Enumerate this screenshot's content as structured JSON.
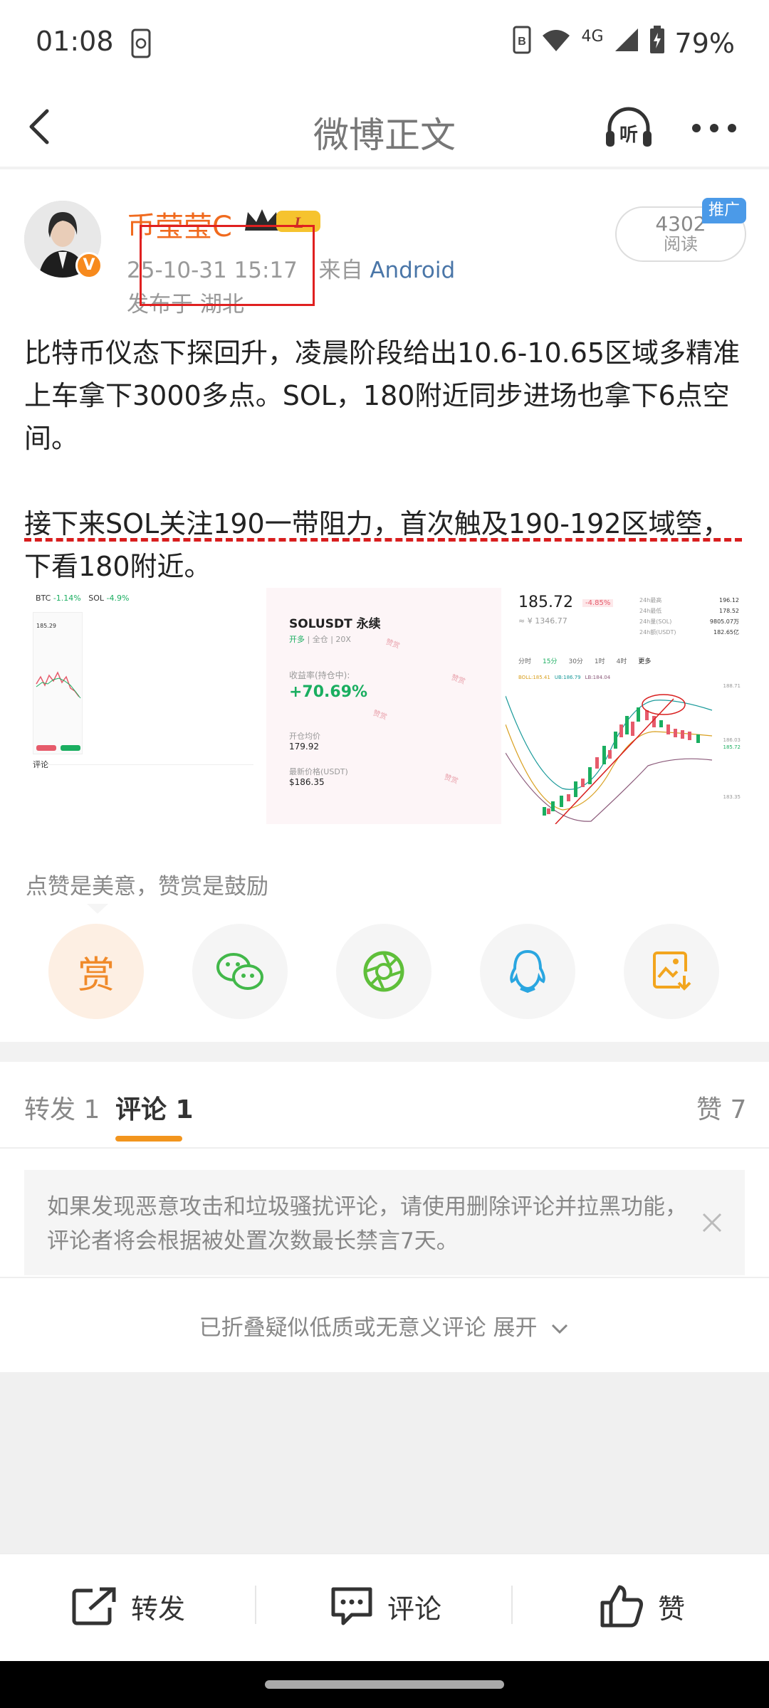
{
  "status": {
    "time": "01:08",
    "network": "4G",
    "battery": "79%"
  },
  "nav": {
    "title": "微博正文"
  },
  "post": {
    "username": "币莹莹C",
    "level_badge": "L",
    "date": "25-10-31 15:17",
    "source_prefix": "来自",
    "source": "Android",
    "location": "发布于 湖北",
    "reads": "4302",
    "reads_label": "阅读",
    "promo": "推广",
    "paragraph1": "比特币仪态下探回升，凌晨阶段给出10.6-10.65区域多精准上车拿下3000多点。SOL，180附近同步进场也拿下6点空间。",
    "paragraph2": "接下来SOL关注190一带阻力，首次触及190-192区域箜，下看180附近。"
  },
  "images": {
    "img1": {
      "ticker1": "BTC",
      "ticker1_change": "-1.14%",
      "ticker2": "SOL",
      "ticker2_change": "-4.9%",
      "price": "185.29",
      "tab": "评论"
    },
    "img2": {
      "symbol": "SOLUSDT 永续",
      "side": "开多",
      "mode": "全仓",
      "leverage": "20X",
      "roi_label": "收益率(持仓中):",
      "roi": "+70.69%",
      "entry_label": "开仓均价",
      "entry": "179.92",
      "last_label": "最新价格(USDT)",
      "last": "$186.35",
      "watermark": "赞赏"
    },
    "img3": {
      "price": "185.72",
      "change": "-4.85%",
      "cny": "≈ ¥ 1346.77",
      "stats": [
        {
          "label": "24h最高",
          "value": "196.12"
        },
        {
          "label": "24h最低",
          "value": "178.52"
        },
        {
          "label": "24h量(SOL)",
          "value": "9805.07万"
        },
        {
          "label": "24h额(USDT)",
          "value": "182.65亿"
        }
      ],
      "intervals": [
        "分时",
        "15分",
        "30分",
        "1时",
        "4时",
        "更多"
      ],
      "boll": "BOLL:185.41",
      "ub": "UB:186.79",
      "lb": "LB:184.04",
      "y_top": "188.71",
      "y_mid": "185.72",
      "y_mid2": "186.03",
      "y_low": "183.35"
    }
  },
  "encourage": {
    "text": "点赞是美意，赞赏是鼓励",
    "reward_label": "赏"
  },
  "tabs": {
    "repost": "转发 1",
    "comment": "评论 1",
    "like": "赞 7"
  },
  "notice": "如果发现恶意攻击和垃圾骚扰评论，请使用删除评论并拉黑功能，评论者将会根据被处置次数最长禁言7天。",
  "collapsed": "已折叠疑似低质或无意义评论 展开",
  "actions": {
    "repost": "转发",
    "comment": "评论",
    "like": "赞"
  },
  "colors": {
    "accent": "#f2951e",
    "username": "#f06a1e",
    "link": "#4a76a8",
    "annotation_red": "#e02020",
    "positive": "#1aae60"
  }
}
